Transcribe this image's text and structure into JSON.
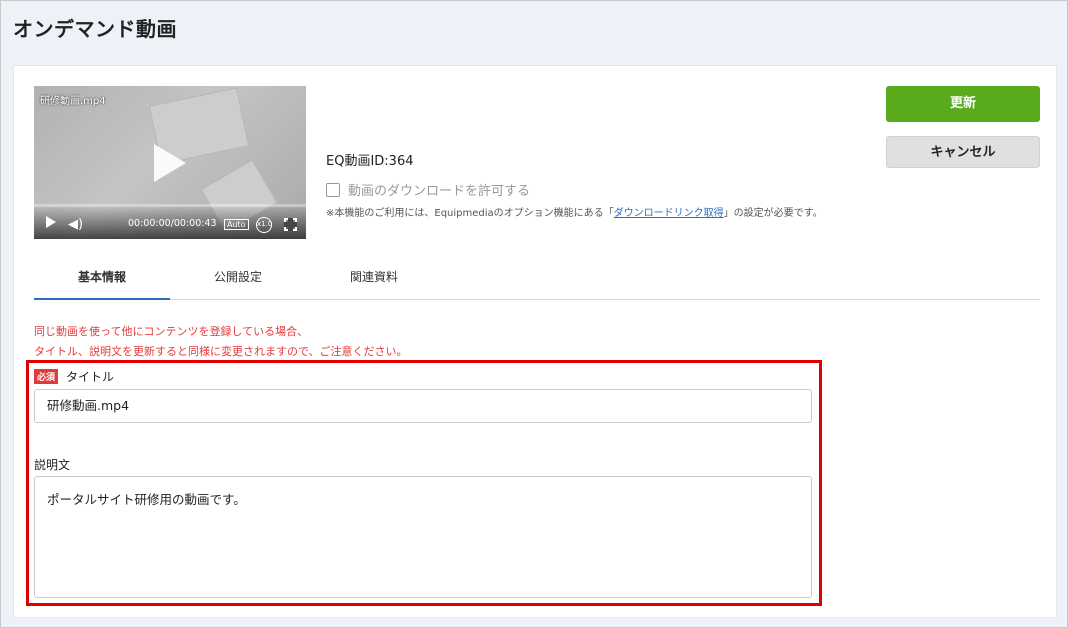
{
  "page": {
    "title": "オンデマンド動画"
  },
  "video": {
    "filename": "研修動画.mp4",
    "time": "00:00:00/00:00:43",
    "quality": "Auto",
    "speed": "x1.0"
  },
  "meta": {
    "eq_id": "EQ動画ID:364",
    "download_label": "動画のダウンロードを許可する",
    "download_checked": false,
    "note_prefix": "※本機能のご利用には、Equipmediaのオプション機能にある「",
    "note_link": "ダウンロードリンク取得",
    "note_suffix": "」の設定が必要です。"
  },
  "buttons": {
    "update": "更新",
    "cancel": "キャンセル"
  },
  "tabs": [
    {
      "label": "基本情報",
      "active": true
    },
    {
      "label": "公開設定",
      "active": false
    },
    {
      "label": "関連資料",
      "active": false
    }
  ],
  "warning": {
    "line1": "同じ動画を使って他にコンテンツを登録している場合、",
    "line2": "タイトル、説明文を更新すると同様に変更されますので、ご注意ください。"
  },
  "form": {
    "required_badge": "必須",
    "title_label": "タイトル",
    "title_value": "研修動画.mp4",
    "description_label": "説明文",
    "description_value": "ポータルサイト研修用の動画です。"
  },
  "colors": {
    "accent_green": "#5aaa1e",
    "warning_red": "#e23b3b",
    "highlight_red": "#e00000",
    "link_blue": "#2a6dc0"
  }
}
